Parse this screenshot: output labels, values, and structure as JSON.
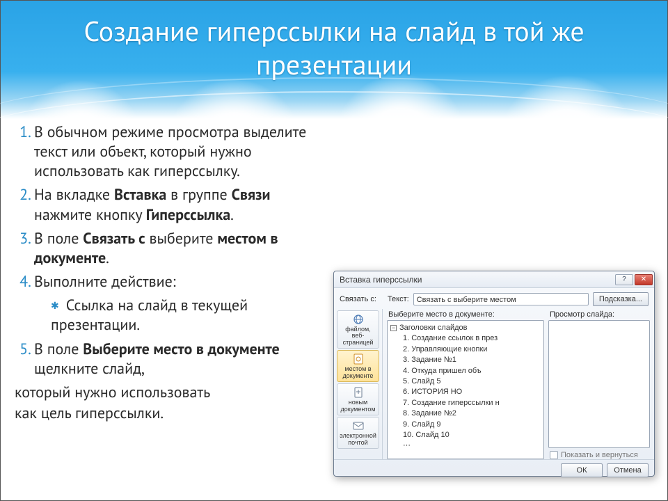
{
  "title": "Создание гиперссылки на слайд в той же презентации",
  "steps": {
    "s1": {
      "t": "В обычном режиме просмотра выделите текст или объект, который нужно использовать как гиперссылку."
    },
    "s2": {
      "a": "На вкладке ",
      "b1": "Вставка",
      "c": " в группе ",
      "b2": "Связи",
      "d": " нажмите кнопку ",
      "b3": "Гиперссылка",
      "e": "."
    },
    "s3": {
      "a": "В поле ",
      "b1": "Связать с",
      "c": " выберите ",
      "b2": "местом в документе",
      "d": "."
    },
    "s4": {
      "a": "Выполните действие:",
      "sub": "Ссылка на слайд в текущей презентации."
    },
    "s5": {
      "a": "В поле ",
      "b1": "Выберите место в документе",
      "c": " щелкните слайд,"
    }
  },
  "tail": {
    "l1": "который нужно использовать",
    "l2": "как цель гиперссылки."
  },
  "dlg": {
    "title": "Вставка гиперссылки",
    "link_with_label": "Связать с:",
    "text_label": "Текст:",
    "text_value": "Связать с выберите местом",
    "hint_btn": "Подсказка...",
    "select_place_label": "Выберите место в документе:",
    "preview_label": "Просмотр слайда:",
    "side": {
      "file": "файлом, веб-страницей",
      "doc": "местом в документе",
      "new": "новым документом",
      "mail": "электронной почтой"
    },
    "tree": {
      "root": "Заголовки слайдов",
      "items": [
        "1. Создание ссылок в през",
        "2. Управляющие кнопки",
        "3. Задание №1",
        "4. Откуда пришел      объ",
        "5. Слайд 5",
        "6.         ИСТОРИЯ       НО",
        "7. Создание гиперссылки н",
        "8. Задание №2",
        "9. Слайд 9",
        "10. Слайд 10"
      ]
    },
    "show_return": "Показать и вернуться",
    "ok": "ОК",
    "cancel": "Отмена"
  }
}
